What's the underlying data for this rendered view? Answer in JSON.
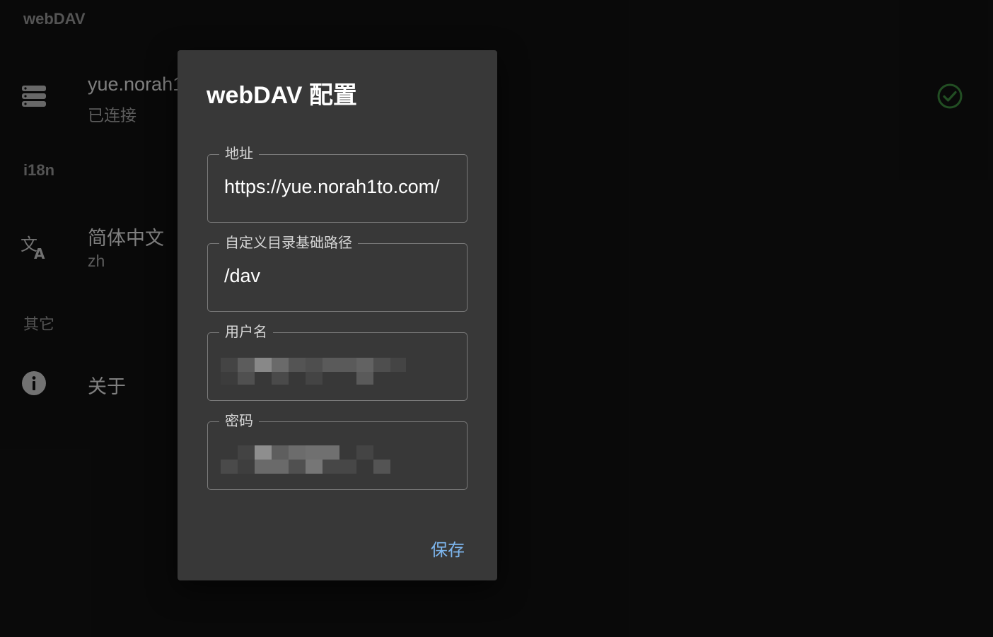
{
  "sections": {
    "webdav_header": "webDAV",
    "i18n_header": "i18n",
    "other_header": "其它"
  },
  "webdav_item": {
    "title": "yue.norah1to.com/dav",
    "subtitle": "已连接",
    "icon": "server-icon",
    "status_icon": "check-circle-icon",
    "status_color": "#3e8e41"
  },
  "language_item": {
    "title": "简体中文",
    "subtitle": "zh",
    "icon": "translate-icon"
  },
  "about_item": {
    "title": "关于",
    "icon": "info-icon"
  },
  "dialog": {
    "title": "webDAV 配置",
    "fields": {
      "address": {
        "label": "地址",
        "value": "https://yue.norah1to.com/"
      },
      "base_path": {
        "label": "自定义目录基础路径",
        "value": "/dav"
      },
      "username": {
        "label": "用户名"
      },
      "password": {
        "label": "密码"
      }
    },
    "save_label": "保存"
  },
  "colors": {
    "background": "#121212",
    "dialog": "#383838",
    "accent": "#7db6ee"
  }
}
